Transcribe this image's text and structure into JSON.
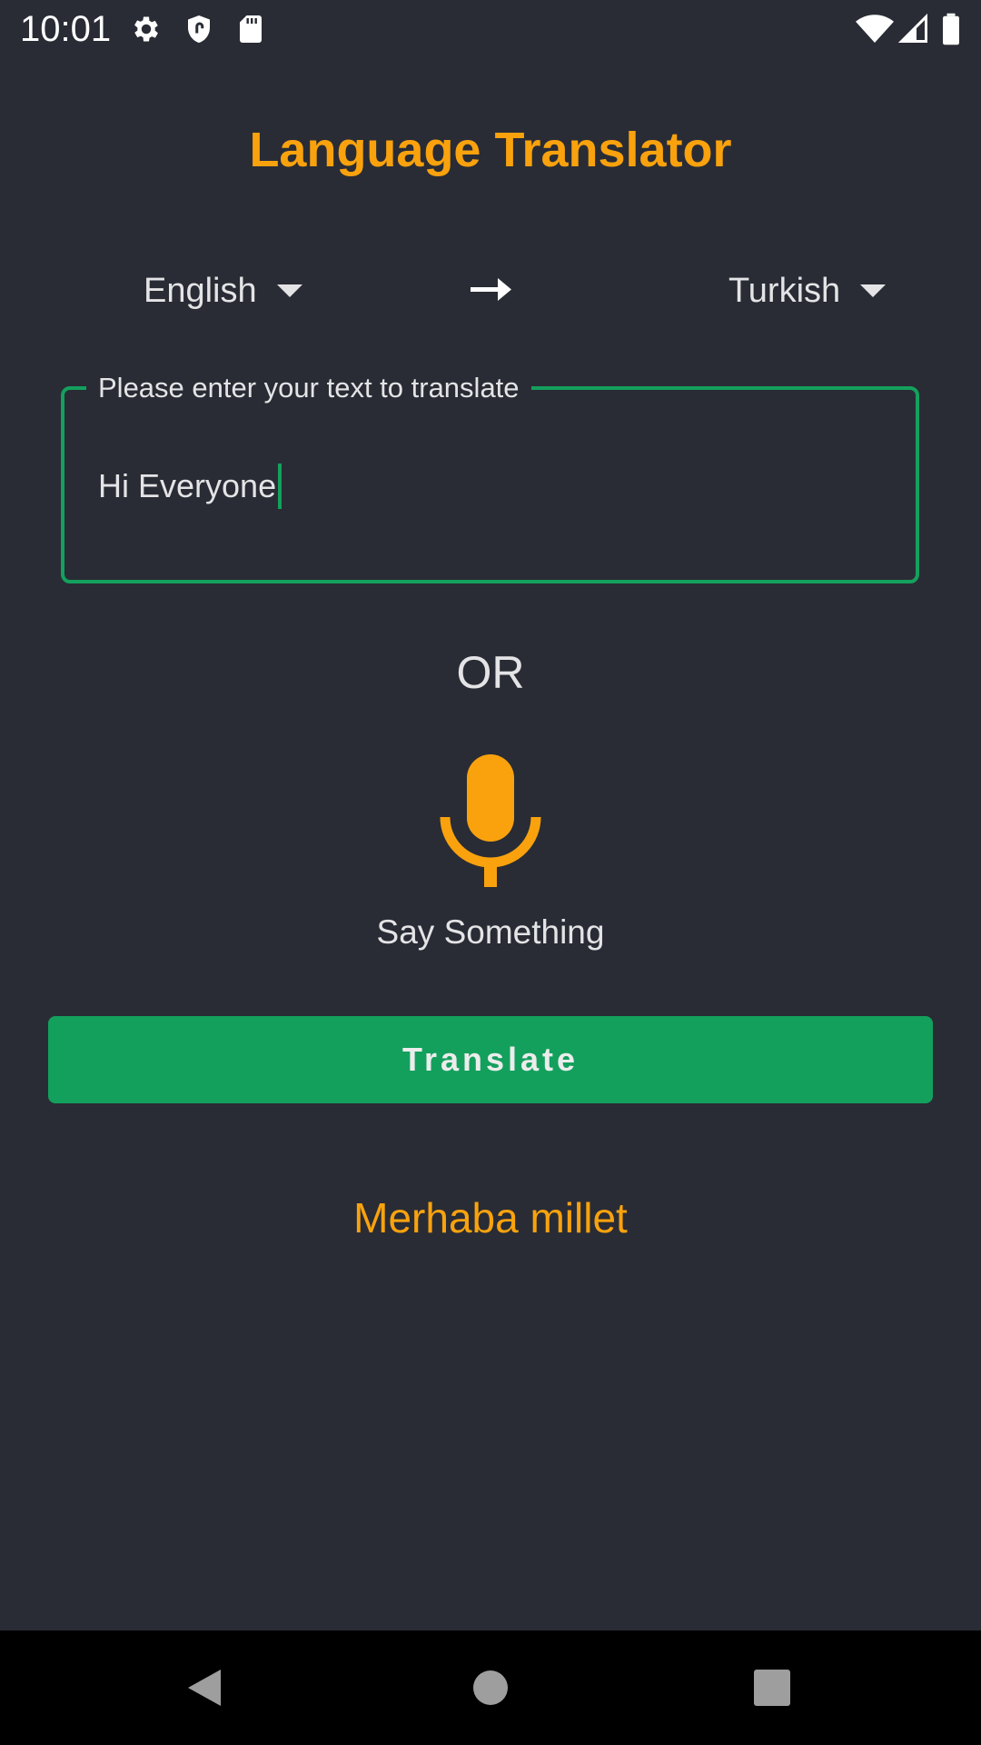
{
  "status_bar": {
    "time": "10:01",
    "icons": [
      "settings-icon",
      "shield-icon",
      "sd-card-icon",
      "wifi-icon",
      "signal-icon",
      "battery-icon"
    ]
  },
  "app": {
    "title": "Language Translator"
  },
  "languages": {
    "source": "English",
    "target": "Turkish",
    "arrow_icon": "arrow-right-icon"
  },
  "input": {
    "label": "Please enter your text to translate",
    "value": "Hi Everyone"
  },
  "divider_text": "OR",
  "voice": {
    "icon": "microphone-icon",
    "label": "Say Something"
  },
  "translate_button": {
    "label": "Translate"
  },
  "result": {
    "text": "Merhaba millet"
  },
  "nav_bar": {
    "icons": [
      "back-icon",
      "home-icon",
      "recents-icon"
    ]
  },
  "colors": {
    "background": "#292c35",
    "accent_orange": "#f9a20e",
    "accent_green": "#13a05d",
    "text": "#e4e4e6",
    "nav_background": "#000000"
  }
}
